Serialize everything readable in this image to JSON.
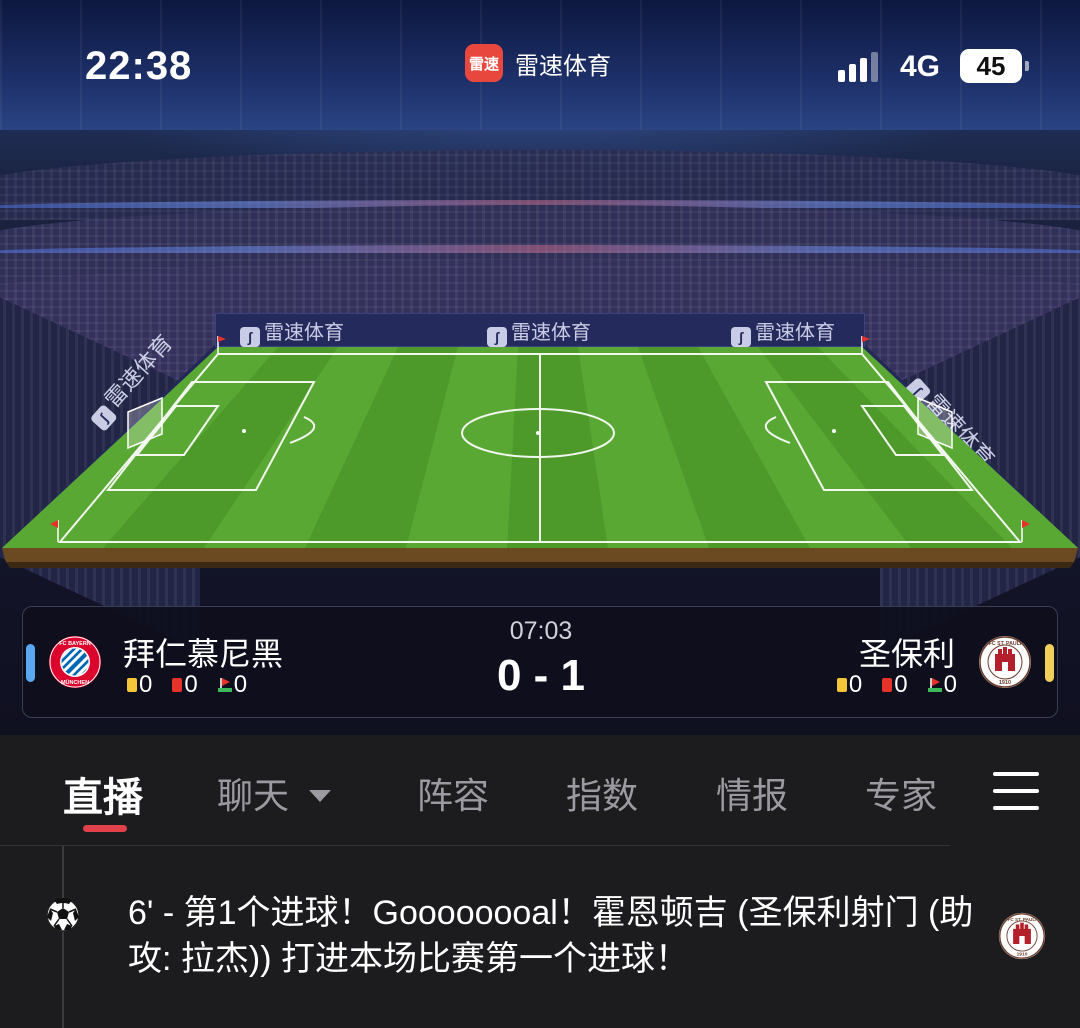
{
  "status_bar": {
    "time": "22:38",
    "app_logo_text": "雷速",
    "app_name": "雷速体育",
    "network": "4G",
    "battery": "45"
  },
  "stadium": {
    "billboard_text": "雷速体育"
  },
  "match": {
    "clock": "07:03",
    "score": "0 - 1",
    "home": {
      "name": "拜仁慕尼黑",
      "crest_text": "FC BAYERN MÜNCHEN",
      "yellow_cards": "0",
      "red_cards": "0",
      "corners": "0",
      "color": "#5aa8f0"
    },
    "away": {
      "name": "圣保利",
      "crest_text": "FC ST. PAULI 1910",
      "yellow_cards": "0",
      "red_cards": "0",
      "corners": "0",
      "color": "#f0d05a"
    }
  },
  "tabs": {
    "live": "直播",
    "chat": "聊天",
    "lineup": "阵容",
    "odds": "指数",
    "intel": "情报",
    "expert": "专家"
  },
  "feed": [
    {
      "icon": "soccer-ball-icon",
      "text": "6' - 第1个进球！Goooooooal！霍恩顿吉 (圣保利射门 (助攻: 拉杰)) 打进本场比赛第一个进球！"
    }
  ],
  "colors": {
    "accent": "#e0414b",
    "pitch_green": "#4f9a2c"
  }
}
